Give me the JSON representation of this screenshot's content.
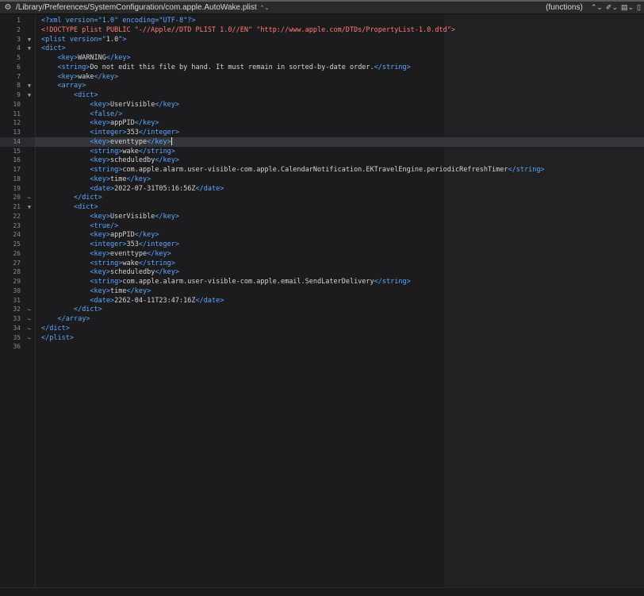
{
  "nav": {
    "path": "/Library/Preferences/SystemConfiguration/com.apple.AutoWake.plist",
    "functions_label": "(functions)",
    "icons": [
      "gear-icon",
      "stepper-icon",
      "pin-icon",
      "bookmark-icon",
      "document-icon"
    ]
  },
  "colors": {
    "tag": "#5fa8ff",
    "declaration": "#ff7b72",
    "text": "#d4d4d4",
    "line_number": "#8a8a8e",
    "background": "#1c1c1e"
  },
  "editor": {
    "current_line": 14,
    "lines": [
      {
        "n": "1",
        "fold": "",
        "code": [
          {
            "k": "t",
            "v": "<?xml version=\"1.0\" encoding=\"UTF-8\"?>"
          }
        ]
      },
      {
        "n": "2",
        "fold": "",
        "code": [
          {
            "k": "s",
            "v": "<!DOCTYPE plist PUBLIC \"-//Apple//DTD PLIST 1.0//EN\" \"http://www.apple.com/DTDs/PropertyList-1.0.dtd\">"
          }
        ]
      },
      {
        "n": "3",
        "fold": "▼",
        "code": [
          {
            "k": "t",
            "v": "<plist version=\""
          },
          {
            "k": "txt",
            "v": "1.0"
          },
          {
            "k": "t",
            "v": "\">"
          }
        ]
      },
      {
        "n": "4",
        "fold": "▼",
        "code": [
          {
            "k": "t",
            "v": "<dict>"
          }
        ]
      },
      {
        "n": "5",
        "fold": "",
        "code": [
          {
            "k": "txt",
            "v": "    "
          },
          {
            "k": "t",
            "v": "<key>"
          },
          {
            "k": "txt",
            "v": "WARNING"
          },
          {
            "k": "t",
            "v": "</key>"
          }
        ]
      },
      {
        "n": "6",
        "fold": "",
        "code": [
          {
            "k": "txt",
            "v": "    "
          },
          {
            "k": "t",
            "v": "<string>"
          },
          {
            "k": "txt",
            "v": "Do not edit this file by hand. It must remain in sorted-by-date order."
          },
          {
            "k": "t",
            "v": "</string>"
          }
        ]
      },
      {
        "n": "7",
        "fold": "",
        "code": [
          {
            "k": "txt",
            "v": "    "
          },
          {
            "k": "t",
            "v": "<key>"
          },
          {
            "k": "txt",
            "v": "wake"
          },
          {
            "k": "t",
            "v": "</key>"
          }
        ]
      },
      {
        "n": "8",
        "fold": "▼",
        "code": [
          {
            "k": "txt",
            "v": "    "
          },
          {
            "k": "t",
            "v": "<array>"
          }
        ]
      },
      {
        "n": "9",
        "fold": "▼",
        "code": [
          {
            "k": "txt",
            "v": "        "
          },
          {
            "k": "t",
            "v": "<dict>"
          }
        ]
      },
      {
        "n": "10",
        "fold": "",
        "code": [
          {
            "k": "txt",
            "v": "            "
          },
          {
            "k": "t",
            "v": "<key>"
          },
          {
            "k": "txt",
            "v": "UserVisible"
          },
          {
            "k": "t",
            "v": "</key>"
          }
        ]
      },
      {
        "n": "11",
        "fold": "",
        "code": [
          {
            "k": "txt",
            "v": "            "
          },
          {
            "k": "t",
            "v": "<false/>"
          }
        ]
      },
      {
        "n": "12",
        "fold": "",
        "code": [
          {
            "k": "txt",
            "v": "            "
          },
          {
            "k": "t",
            "v": "<key>"
          },
          {
            "k": "txt",
            "v": "appPID"
          },
          {
            "k": "t",
            "v": "</key>"
          }
        ]
      },
      {
        "n": "13",
        "fold": "",
        "code": [
          {
            "k": "txt",
            "v": "            "
          },
          {
            "k": "t",
            "v": "<integer>"
          },
          {
            "k": "txt",
            "v": "353"
          },
          {
            "k": "t",
            "v": "</integer>"
          }
        ]
      },
      {
        "n": "14",
        "fold": "",
        "code": [
          {
            "k": "txt",
            "v": "            "
          },
          {
            "k": "t",
            "v": "<key>"
          },
          {
            "k": "txt",
            "v": "eventtype"
          },
          {
            "k": "t",
            "v": "</key>"
          },
          {
            "k": "cursor",
            "v": ""
          }
        ]
      },
      {
        "n": "15",
        "fold": "",
        "code": [
          {
            "k": "txt",
            "v": "            "
          },
          {
            "k": "t",
            "v": "<string>"
          },
          {
            "k": "txt",
            "v": "wake"
          },
          {
            "k": "t",
            "v": "</string>"
          }
        ]
      },
      {
        "n": "16",
        "fold": "",
        "code": [
          {
            "k": "txt",
            "v": "            "
          },
          {
            "k": "t",
            "v": "<key>"
          },
          {
            "k": "txt",
            "v": "scheduledby"
          },
          {
            "k": "t",
            "v": "</key>"
          }
        ]
      },
      {
        "n": "17",
        "fold": "",
        "code": [
          {
            "k": "txt",
            "v": "            "
          },
          {
            "k": "t",
            "v": "<string>"
          },
          {
            "k": "txt",
            "v": "com.apple.alarm.user-visible-com.apple.CalendarNotification.EKTravelEngine.periodicRefreshTimer"
          },
          {
            "k": "t",
            "v": "</string>"
          }
        ]
      },
      {
        "n": "18",
        "fold": "",
        "code": [
          {
            "k": "txt",
            "v": "            "
          },
          {
            "k": "t",
            "v": "<key>"
          },
          {
            "k": "txt",
            "v": "time"
          },
          {
            "k": "t",
            "v": "</key>"
          }
        ]
      },
      {
        "n": "19",
        "fold": "",
        "code": [
          {
            "k": "txt",
            "v": "            "
          },
          {
            "k": "t",
            "v": "<date>"
          },
          {
            "k": "txt",
            "v": "2022-07-31T05:16:56Z"
          },
          {
            "k": "t",
            "v": "</date>"
          }
        ]
      },
      {
        "n": "20",
        "fold": "⌙",
        "code": [
          {
            "k": "txt",
            "v": "        "
          },
          {
            "k": "t",
            "v": "</dict>"
          }
        ]
      },
      {
        "n": "21",
        "fold": "▼",
        "code": [
          {
            "k": "txt",
            "v": "        "
          },
          {
            "k": "t",
            "v": "<dict>"
          }
        ]
      },
      {
        "n": "22",
        "fold": "",
        "code": [
          {
            "k": "txt",
            "v": "            "
          },
          {
            "k": "t",
            "v": "<key>"
          },
          {
            "k": "txt",
            "v": "UserVisible"
          },
          {
            "k": "t",
            "v": "</key>"
          }
        ]
      },
      {
        "n": "23",
        "fold": "",
        "code": [
          {
            "k": "txt",
            "v": "            "
          },
          {
            "k": "t",
            "v": "<true/>"
          }
        ]
      },
      {
        "n": "24",
        "fold": "",
        "code": [
          {
            "k": "txt",
            "v": "            "
          },
          {
            "k": "t",
            "v": "<key>"
          },
          {
            "k": "txt",
            "v": "appPID"
          },
          {
            "k": "t",
            "v": "</key>"
          }
        ]
      },
      {
        "n": "25",
        "fold": "",
        "code": [
          {
            "k": "txt",
            "v": "            "
          },
          {
            "k": "t",
            "v": "<integer>"
          },
          {
            "k": "txt",
            "v": "353"
          },
          {
            "k": "t",
            "v": "</integer>"
          }
        ]
      },
      {
        "n": "26",
        "fold": "",
        "code": [
          {
            "k": "txt",
            "v": "            "
          },
          {
            "k": "t",
            "v": "<key>"
          },
          {
            "k": "txt",
            "v": "eventtype"
          },
          {
            "k": "t",
            "v": "</key>"
          }
        ]
      },
      {
        "n": "27",
        "fold": "",
        "code": [
          {
            "k": "txt",
            "v": "            "
          },
          {
            "k": "t",
            "v": "<string>"
          },
          {
            "k": "txt",
            "v": "wake"
          },
          {
            "k": "t",
            "v": "</string>"
          }
        ]
      },
      {
        "n": "28",
        "fold": "",
        "code": [
          {
            "k": "txt",
            "v": "            "
          },
          {
            "k": "t",
            "v": "<key>"
          },
          {
            "k": "txt",
            "v": "scheduledby"
          },
          {
            "k": "t",
            "v": "</key>"
          }
        ]
      },
      {
        "n": "29",
        "fold": "",
        "code": [
          {
            "k": "txt",
            "v": "            "
          },
          {
            "k": "t",
            "v": "<string>"
          },
          {
            "k": "txt",
            "v": "com.apple.alarm.user-visible-com.apple.email.SendLaterDelivery"
          },
          {
            "k": "t",
            "v": "</string>"
          }
        ]
      },
      {
        "n": "30",
        "fold": "",
        "code": [
          {
            "k": "txt",
            "v": "            "
          },
          {
            "k": "t",
            "v": "<key>"
          },
          {
            "k": "txt",
            "v": "time"
          },
          {
            "k": "t",
            "v": "</key>"
          }
        ]
      },
      {
        "n": "31",
        "fold": "",
        "code": [
          {
            "k": "txt",
            "v": "            "
          },
          {
            "k": "t",
            "v": "<date>"
          },
          {
            "k": "txt",
            "v": "2262-04-11T23:47:16Z"
          },
          {
            "k": "t",
            "v": "</date>"
          }
        ]
      },
      {
        "n": "32",
        "fold": "⌙",
        "code": [
          {
            "k": "txt",
            "v": "        "
          },
          {
            "k": "t",
            "v": "</dict>"
          }
        ]
      },
      {
        "n": "33",
        "fold": "⌙",
        "code": [
          {
            "k": "txt",
            "v": "    "
          },
          {
            "k": "t",
            "v": "</array>"
          }
        ]
      },
      {
        "n": "34",
        "fold": "⌙",
        "code": [
          {
            "k": "t",
            "v": "</dict>"
          }
        ]
      },
      {
        "n": "35",
        "fold": "⌙",
        "code": [
          {
            "k": "t",
            "v": "</plist>"
          }
        ]
      },
      {
        "n": "36",
        "fold": "",
        "code": []
      }
    ]
  }
}
